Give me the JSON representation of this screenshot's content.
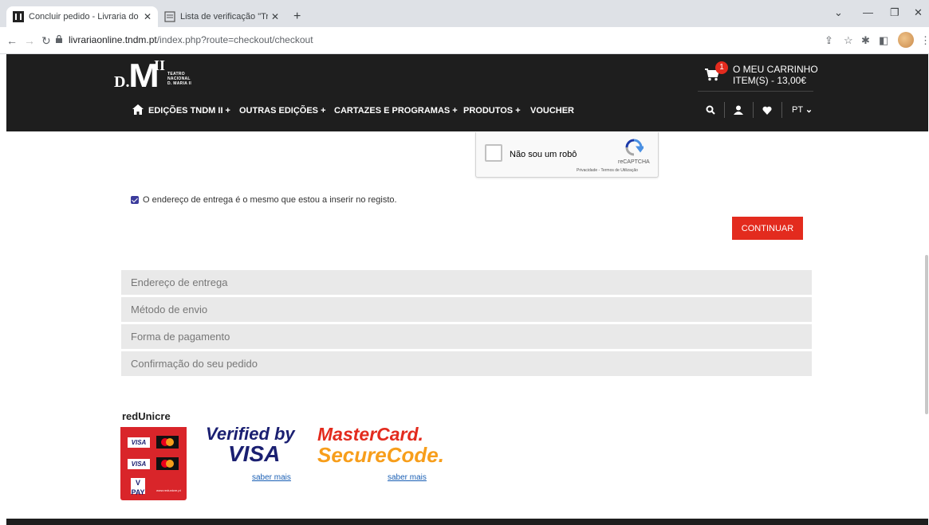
{
  "browser": {
    "tabs": [
      {
        "title": "Concluir pedido - Livraria do Tea",
        "active": true
      },
      {
        "title": "Lista de verificação \"Transação\"",
        "active": false
      }
    ],
    "url_host": "livrariaonline.tndm.pt",
    "url_path": "/index.php?route=checkout/checkout"
  },
  "header": {
    "logo": {
      "d": "D.",
      "m": "M",
      "ii": "II",
      "line1": "TEATRO",
      "line2": "NACIONAL",
      "line3": "D. MARIA II"
    },
    "cart": {
      "badge": "1",
      "title": "O MEU CARRINHO",
      "summary": "ITEM(S) - 13,00€"
    },
    "menu": [
      "EDIÇÕES TNDM II +",
      "OUTRAS EDIÇÕES +",
      "CARTAZES E PROGRAMAS +",
      "PRODUTOS +",
      "VOUCHER"
    ],
    "lang": "PT"
  },
  "recaptcha": {
    "label": "Não sou um robô",
    "brand": "reCAPTCHA",
    "privacy": "Privacidade - Termos de Utilização"
  },
  "form": {
    "same_address_label": "O endereço de entrega é o mesmo que estou a inserir no registo.",
    "same_address_checked": true,
    "continue_label": "CONTINUAR"
  },
  "panels": [
    "Endereço de entrega",
    "Método de envio",
    "Forma de pagamento",
    "Confirmação do seu pedido"
  ],
  "payment": {
    "redunicre": "redUnicre",
    "redunicre_url": "www.redunicre.pt",
    "vbv_line1": "Verified by",
    "vbv_line2": "VISA",
    "mc_line1": "MasterCard.",
    "mc_line2": "SecureCode.",
    "saber_mais": "saber mais",
    "visa_mini": "VISA",
    "vpay": "V PAY"
  },
  "colors": {
    "accent": "#e32b1e",
    "header_bg": "#1e1e1e",
    "panel_bg": "#e9e9e9"
  }
}
